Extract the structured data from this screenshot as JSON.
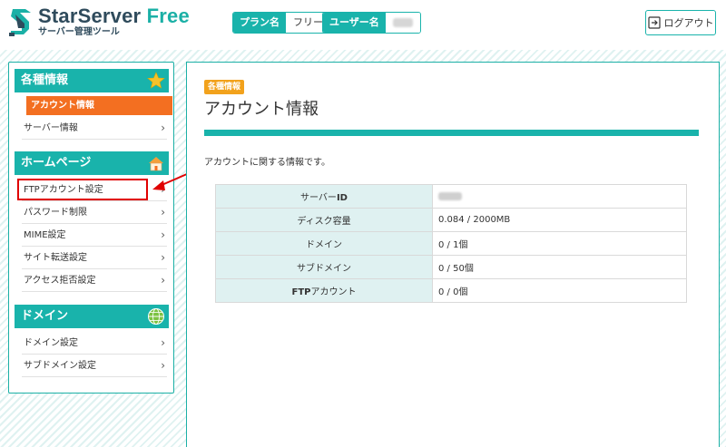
{
  "header": {
    "logo_title_main": "StarServer",
    "logo_title_accent": " Free",
    "logo_subtitle": "サーバー管理ツール",
    "plan_label": "プラン名",
    "plan_value": "フリー",
    "user_label": "ユーザー名",
    "logout_label": "ログアウト"
  },
  "sidebar": {
    "sections": [
      {
        "title": "各種情報",
        "icon": "star-icon"
      },
      {
        "title": "ホームページ",
        "icon": "house-icon"
      },
      {
        "title": "ドメイン",
        "icon": "globe-icon"
      }
    ],
    "info_items": [
      "アカウント情報",
      "サーバー情報"
    ],
    "homepage_items": [
      "FTPアカウント設定",
      "パスワード制限",
      "MIME設定",
      "サイト転送設定",
      "アクセス拒否設定"
    ],
    "domain_items": [
      "ドメイン設定",
      "サブドメイン設定"
    ],
    "active_item": "アカウント情報",
    "highlighted_item": "FTPアカウント設定"
  },
  "main": {
    "badge": "各種情報",
    "title": "アカウント情報",
    "description": "アカウントに関する情報です。",
    "rows": [
      {
        "key_pre": "サーバー",
        "key_bold": "ID",
        "key_post": "",
        "value": ""
      },
      {
        "key_pre": "ディスク容量",
        "key_bold": "",
        "key_post": "",
        "value": "0.084 / 2000MB"
      },
      {
        "key_pre": "ドメイン",
        "key_bold": "",
        "key_post": "",
        "value": "0 / 1個"
      },
      {
        "key_pre": "サブドメイン",
        "key_bold": "",
        "key_post": "",
        "value": "0 / 50個"
      },
      {
        "key_pre": "",
        "key_bold": "FTP",
        "key_post": "アカウント",
        "value": "0 / 0個"
      }
    ]
  },
  "colors": {
    "teal": "#19b3ab",
    "orange": "#f36f21",
    "badge": "#f2a21c",
    "annotation_red": "#e00000"
  }
}
